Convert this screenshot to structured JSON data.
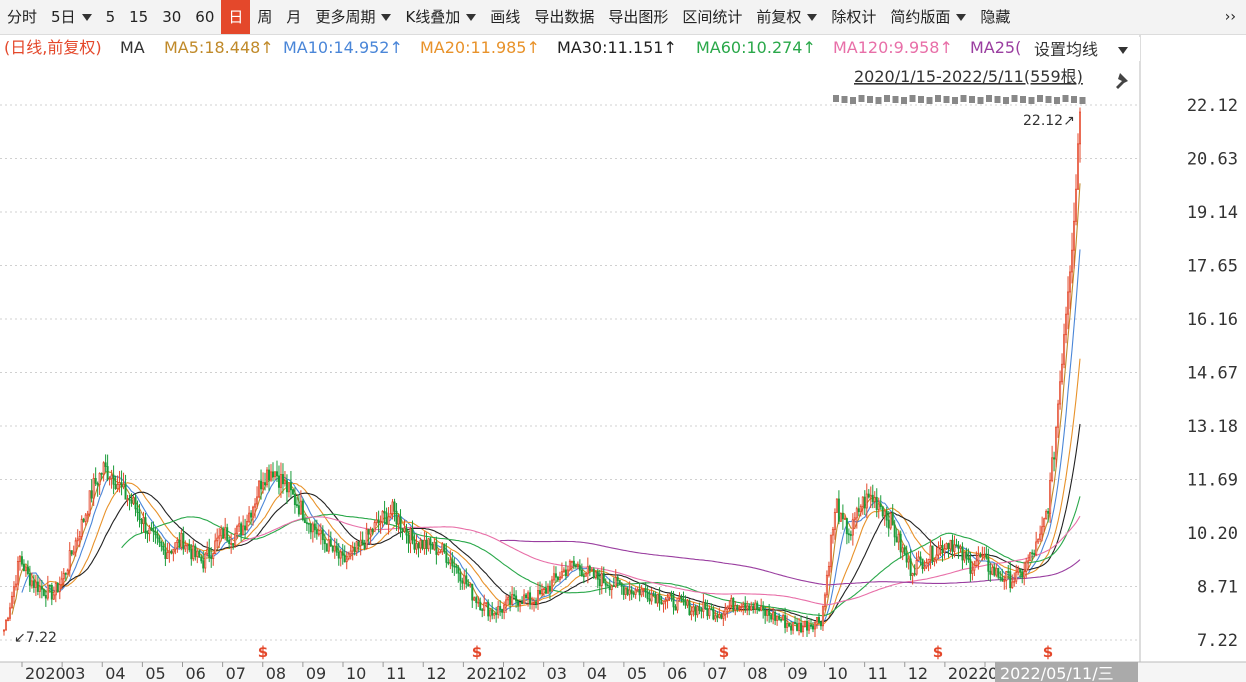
{
  "toolbar": {
    "items": [
      {
        "label": "分时",
        "dropdown": false,
        "active": false
      },
      {
        "label": "5日",
        "dropdown": true,
        "active": false
      },
      {
        "label": "5",
        "dropdown": false,
        "active": false
      },
      {
        "label": "15",
        "dropdown": false,
        "active": false
      },
      {
        "label": "30",
        "dropdown": false,
        "active": false
      },
      {
        "label": "60",
        "dropdown": false,
        "active": false
      },
      {
        "label": "日",
        "dropdown": false,
        "active": true
      },
      {
        "label": "周",
        "dropdown": false,
        "active": false
      },
      {
        "label": "月",
        "dropdown": false,
        "active": false
      },
      {
        "label": "更多周期",
        "dropdown": true,
        "active": false
      },
      {
        "label": "K线叠加",
        "dropdown": true,
        "active": false
      },
      {
        "label": "画线",
        "dropdown": false,
        "active": false
      },
      {
        "label": "导出数据",
        "dropdown": false,
        "active": false
      },
      {
        "label": "导出图形",
        "dropdown": false,
        "active": false
      },
      {
        "label": "区间统计",
        "dropdown": false,
        "active": false
      },
      {
        "label": "前复权",
        "dropdown": true,
        "active": false
      },
      {
        "label": "除权计",
        "dropdown": false,
        "active": false
      },
      {
        "label": "简约版面",
        "dropdown": true,
        "active": false
      },
      {
        "label": "隐藏",
        "dropdown": false,
        "active": false
      }
    ],
    "more_icon": "double-chevron-right-icon",
    "more_text": "››"
  },
  "legend": {
    "prefix": "(日线,前复权)",
    "ma_label": "MA",
    "items": [
      {
        "text": "MA5:18.448↑",
        "color": "#c08a2a"
      },
      {
        "text": "MA10:14.952↑",
        "color": "#4a86d8"
      },
      {
        "text": "MA20:11.985↑",
        "color": "#e8922a"
      },
      {
        "text": "MA30:11.151↑",
        "color": "#222222"
      },
      {
        "text": "MA60:10.274↑",
        "color": "#2aa84a"
      },
      {
        "text": "MA120:9.958↑",
        "color": "#e86fa8"
      },
      {
        "text": "MA25(",
        "color": "#9a3ea0"
      }
    ],
    "setting_label": "设置均线",
    "range_text": "2020/1/15-2022/5/11(559根)",
    "pin_icon": "pin-icon",
    "marker_text": "22.12↗",
    "low_text": "↙7.22"
  },
  "chart_data": {
    "type": "candlestick",
    "period": "2020/1/15-2022/5/11",
    "bar_count": 559,
    "y_ticks": [
      "22.12",
      "20.63",
      "19.14",
      "17.65",
      "16.16",
      "14.67",
      "13.18",
      "11.69",
      "10.20",
      "8.71",
      "7.22"
    ],
    "ylim": [
      7.22,
      22.12
    ],
    "high": 22.12,
    "low": 7.22,
    "x_ticks": [
      "2020",
      "03",
      "04",
      "05",
      "06",
      "07",
      "08",
      "09",
      "10",
      "11",
      "12",
      "2021",
      "02",
      "03",
      "04",
      "05",
      "06",
      "07",
      "08",
      "09",
      "10",
      "11",
      "12",
      "2022",
      "0"
    ],
    "x_last_label": "2022/05/11/三",
    "dividend_marks": [
      "08",
      "2021",
      "07",
      "12",
      "2022-04"
    ],
    "dividend_symbol": "$",
    "close_path": [
      [
        0,
        7.5
      ],
      [
        5,
        8.7
      ],
      [
        8,
        9.5
      ],
      [
        12,
        9.0
      ],
      [
        15,
        8.8
      ],
      [
        20,
        8.6
      ],
      [
        25,
        8.5
      ],
      [
        30,
        9.0
      ],
      [
        35,
        9.8
      ],
      [
        40,
        10.6
      ],
      [
        45,
        11.5
      ],
      [
        50,
        12.0
      ],
      [
        55,
        11.8
      ],
      [
        60,
        11.3
      ],
      [
        65,
        11.0
      ],
      [
        70,
        10.5
      ],
      [
        75,
        10.0
      ],
      [
        80,
        9.7
      ],
      [
        85,
        9.8
      ],
      [
        90,
        10.0
      ],
      [
        95,
        9.6
      ],
      [
        100,
        9.4
      ],
      [
        105,
        9.8
      ],
      [
        110,
        10.2
      ],
      [
        115,
        10.1
      ],
      [
        120,
        10.4
      ],
      [
        125,
        11.0
      ],
      [
        130,
        11.8
      ],
      [
        135,
        12.0
      ],
      [
        140,
        11.6
      ],
      [
        145,
        11.2
      ],
      [
        150,
        10.8
      ],
      [
        155,
        10.4
      ],
      [
        160,
        10.0
      ],
      [
        165,
        9.7
      ],
      [
        170,
        9.4
      ],
      [
        175,
        9.6
      ],
      [
        180,
        9.9
      ],
      [
        185,
        10.3
      ],
      [
        190,
        10.6
      ],
      [
        195,
        10.8
      ],
      [
        200,
        10.4
      ],
      [
        205,
        10.0
      ],
      [
        210,
        9.9
      ],
      [
        215,
        9.8
      ],
      [
        220,
        9.7
      ],
      [
        225,
        9.4
      ],
      [
        230,
        9.0
      ],
      [
        235,
        8.5
      ],
      [
        240,
        8.2
      ],
      [
        245,
        8.0
      ],
      [
        250,
        8.1
      ],
      [
        255,
        8.3
      ],
      [
        260,
        8.4
      ],
      [
        265,
        8.3
      ],
      [
        270,
        8.5
      ],
      [
        275,
        8.8
      ],
      [
        280,
        9.1
      ],
      [
        285,
        9.3
      ],
      [
        290,
        9.2
      ],
      [
        295,
        9.0
      ],
      [
        300,
        8.9
      ],
      [
        305,
        8.8
      ],
      [
        310,
        8.7
      ],
      [
        315,
        8.6
      ],
      [
        320,
        8.6
      ],
      [
        325,
        8.5
      ],
      [
        330,
        8.4
      ],
      [
        335,
        8.3
      ],
      [
        340,
        8.2
      ],
      [
        345,
        8.1
      ],
      [
        350,
        8.1
      ],
      [
        355,
        8.0
      ],
      [
        360,
        8.0
      ],
      [
        365,
        8.2
      ],
      [
        370,
        8.3
      ],
      [
        375,
        8.2
      ],
      [
        380,
        8.0
      ],
      [
        385,
        7.9
      ],
      [
        390,
        7.8
      ],
      [
        395,
        7.6
      ],
      [
        400,
        7.6
      ],
      [
        405,
        7.7
      ],
      [
        410,
        7.8
      ],
      [
        412,
        8.5
      ],
      [
        415,
        10.0
      ],
      [
        418,
        11.0
      ],
      [
        420,
        10.5
      ],
      [
        425,
        10.2
      ],
      [
        430,
        11.0
      ],
      [
        435,
        11.2
      ],
      [
        440,
        11.0
      ],
      [
        445,
        10.5
      ],
      [
        450,
        9.8
      ],
      [
        455,
        9.2
      ],
      [
        460,
        9.4
      ],
      [
        465,
        9.6
      ],
      [
        470,
        9.8
      ],
      [
        475,
        10.0
      ],
      [
        480,
        9.6
      ],
      [
        485,
        9.3
      ],
      [
        490,
        9.5
      ],
      [
        495,
        9.2
      ],
      [
        500,
        9.0
      ],
      [
        505,
        8.9
      ],
      [
        510,
        9.0
      ],
      [
        515,
        9.5
      ],
      [
        520,
        10.0
      ],
      [
        524,
        11.0
      ],
      [
        527,
        12.5
      ],
      [
        530,
        14.5
      ],
      [
        533,
        16.5
      ],
      [
        536,
        18.4
      ],
      [
        538,
        20.0
      ],
      [
        540,
        22.1
      ]
    ]
  }
}
